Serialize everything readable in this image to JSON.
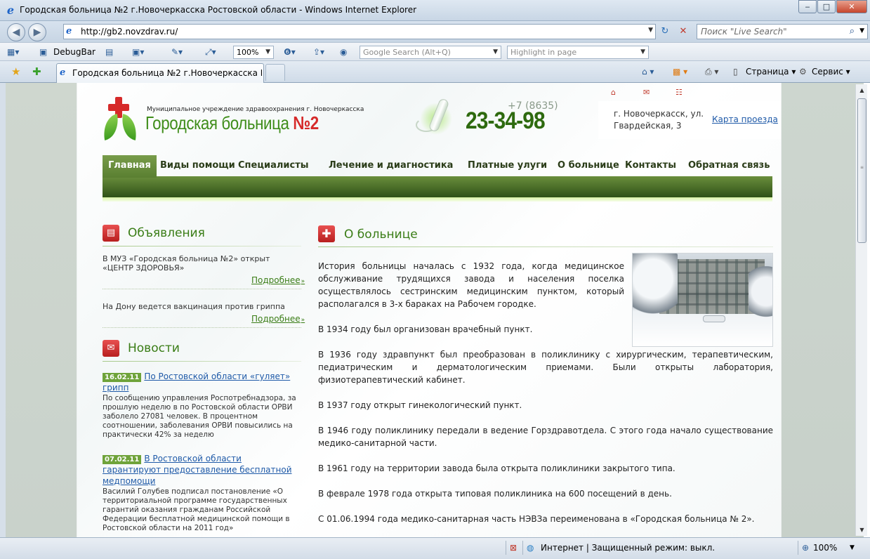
{
  "window": {
    "title": "Городская больница №2 г.Новочеркасска Ростовской области - Windows Internet Explorer",
    "minimize": "‒",
    "maximize": "□",
    "close": "✕"
  },
  "address_bar": {
    "url": "http://gb2.novzdrav.ru/",
    "search_placeholder": "Поиск \"Live Search\""
  },
  "toolbar": {
    "debugbar_label": "DebugBar",
    "zoom_value": "100%",
    "google_search_placeholder": "Google Search (Alt+Q)",
    "highlight_placeholder": "Highlight in page"
  },
  "tabs": {
    "active_tab_label": "Городская больница №2 г.Новочеркасска Рост...",
    "page_menu": "Страница",
    "tools_menu": "Сервис"
  },
  "site": {
    "org_subtitle": "Муниципальное учреждение здравоохранения г. Новочеркасска",
    "org_name": "Городская больница",
    "org_number": "№2",
    "phone_code": "+7 (8635)",
    "phone_number": "23-34-98",
    "address": "г. Новочеркасск, ул. Гвардейская, 3",
    "map_link": "Карта проезда",
    "nav": [
      {
        "label": "Главная",
        "active": true
      },
      {
        "label": "Виды помощи"
      },
      {
        "label": "Специалисты"
      },
      {
        "label": "Лечение и диагностика"
      },
      {
        "label": "Платные улуги"
      },
      {
        "label": "О больнице"
      },
      {
        "label": "Контакты"
      },
      {
        "label": "Обратная связь"
      }
    ]
  },
  "announcements": {
    "title": "Объявления",
    "items": [
      {
        "text": "В МУЗ «Городская больница №2» открыт «ЦЕНТР ЗДОРОВЬЯ»",
        "more": "Подробнее"
      },
      {
        "text": "На Дону ведется вакцинация против гриппа",
        "more": "Подробнее"
      }
    ]
  },
  "news": {
    "title": "Новости",
    "items": [
      {
        "date": "16.02.11",
        "headline": "По Ростовской области «гуляет» грипп",
        "body": "По сообщению управления Роспотребнадзора, за прошлую неделю в по Ростовской области ОРВИ заболело 27081 человек. В процентном соотношении, заболевания ОРВИ повысились на практически 42% за неделю"
      },
      {
        "date": "07.02.11",
        "headline": "В Ростовской области гарантируют предоставление бесплатной медпомощи",
        "body": "Василий Голубев подписал постановление «О территориальной программе государственных гарантий оказания гражданам Российской Федерации бесплатной медицинской помощи в Ростовской области на 2011 год»"
      }
    ]
  },
  "about": {
    "title": "О больнице",
    "paragraphs": [
      "История больницы началась с 1932 года, когда медицинское обслуживание трудящихся завода и населения поселка осуществлялось сестринским медицинским пунктом, который располагался в 3-х бараках на Рабочем городке.",
      "В 1934 году был организован врачебный пункт.",
      "В 1936 году здравпункт был преобразован в поликлинику с хирургическим, терапевтическим, педиатрическим и дерматологическим приемами. Были открыты лаборатория, физиотерапевтический кабинет.",
      "В 1937 году открыт гинекологический пункт.",
      "В 1946 году поликлинику передали в ведение Горздравотдела. С этого года начало существование медико-санитарной части.",
      "В 1961 году на территории завода была открыта поликлиники закрытого типа.",
      "В феврале 1978 года открыта типовая поликлиника на 600 посещений в день.",
      "С 01.06.1994 года медико-санитарная часть НЭВЗа переименована в «Городская больница № 2»."
    ]
  },
  "statusbar": {
    "zone": "Интернет | Защищенный режим: выкл.",
    "zoom": "100%"
  },
  "colors": {
    "brand_green": "#3a7d16",
    "nav_dark": "#2f5218",
    "accent_red": "#d62a2a",
    "link_blue": "#1f5aa8"
  }
}
